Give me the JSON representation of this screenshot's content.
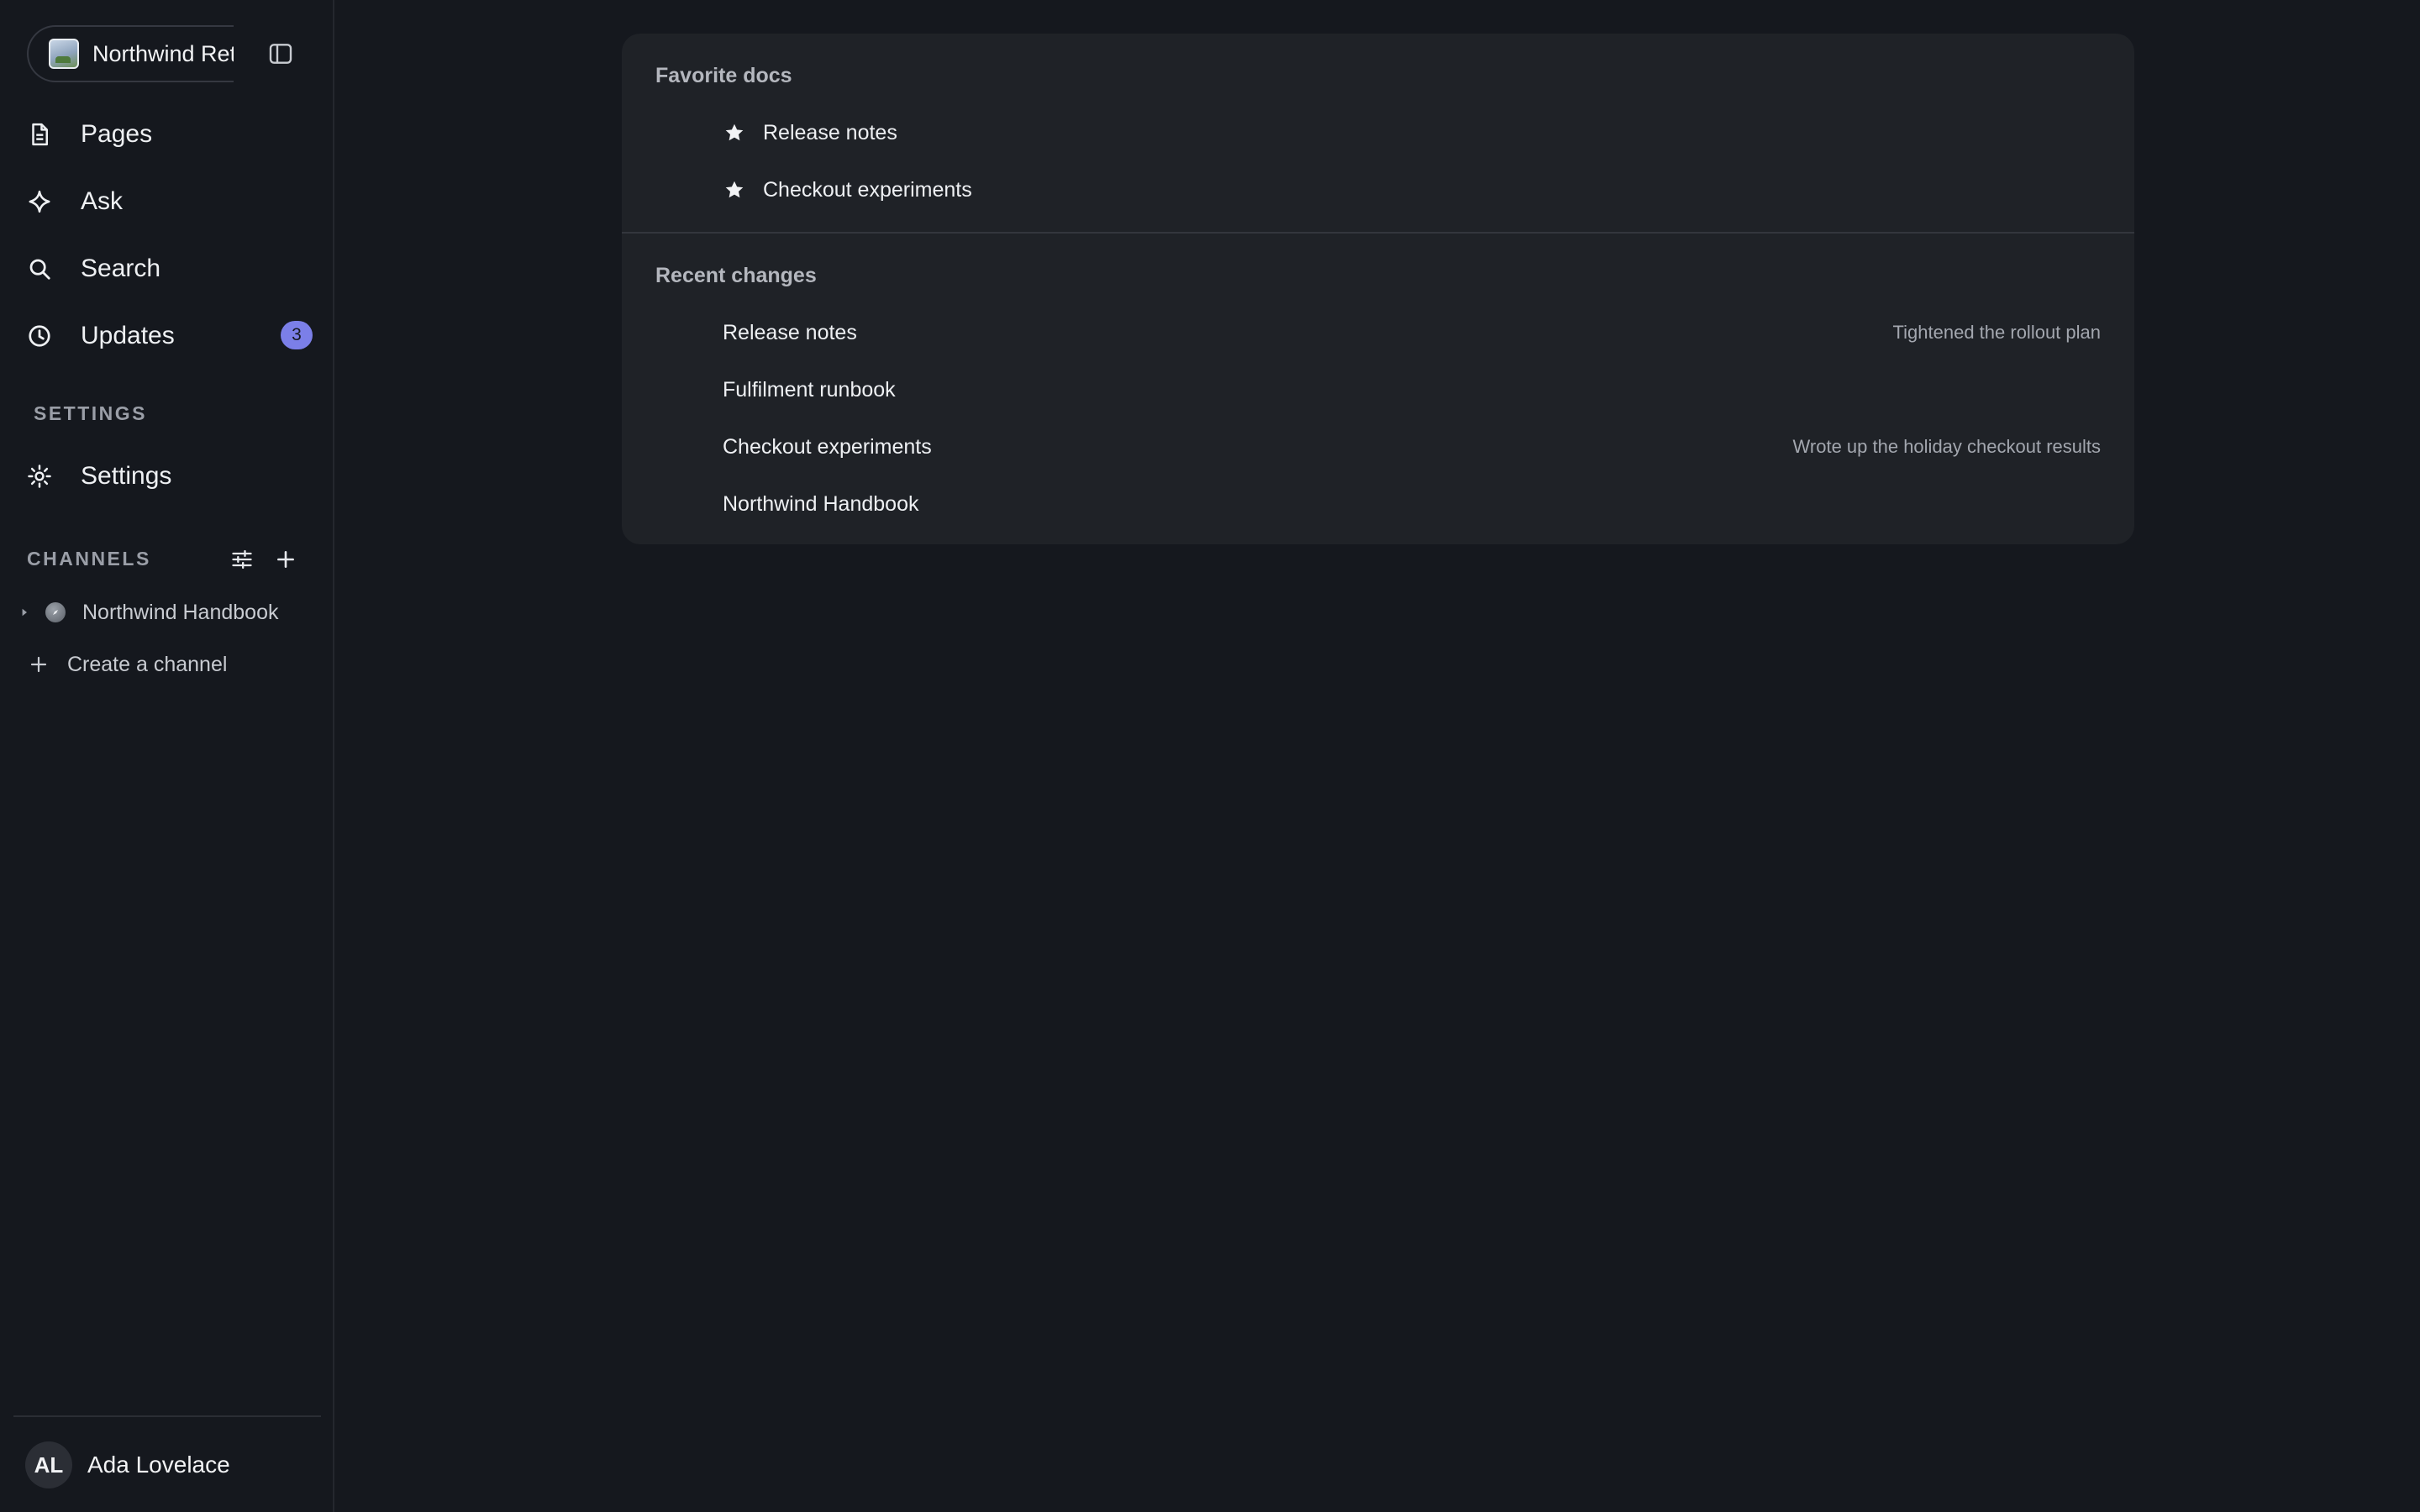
{
  "workspace": {
    "name": "Northwind Retail"
  },
  "nav": {
    "pages": "Pages",
    "ask": "Ask",
    "search": "Search",
    "updates": "Updates",
    "updates_count": "3"
  },
  "settings_section": {
    "heading": "SETTINGS",
    "settings": "Settings"
  },
  "channels": {
    "heading": "CHANNELS",
    "items": [
      {
        "label": "Northwind Handbook"
      }
    ],
    "create_label": "Create a channel"
  },
  "user": {
    "initials": "AL",
    "name": "Ada Lovelace"
  },
  "favorites": {
    "heading": "Favorite docs",
    "items": [
      {
        "label": "Release notes"
      },
      {
        "label": "Checkout experiments"
      }
    ]
  },
  "recent": {
    "heading": "Recent changes",
    "items": [
      {
        "label": "Release notes",
        "note": "Tightened the rollout plan"
      },
      {
        "label": "Fulfilment runbook",
        "note": ""
      },
      {
        "label": "Checkout experiments",
        "note": "Wrote up the holiday checkout results"
      },
      {
        "label": "Northwind Handbook",
        "note": ""
      }
    ]
  },
  "colors": {
    "accent_badge": "#7b7fe8",
    "background": "#15181e",
    "card": "#1f2227"
  }
}
